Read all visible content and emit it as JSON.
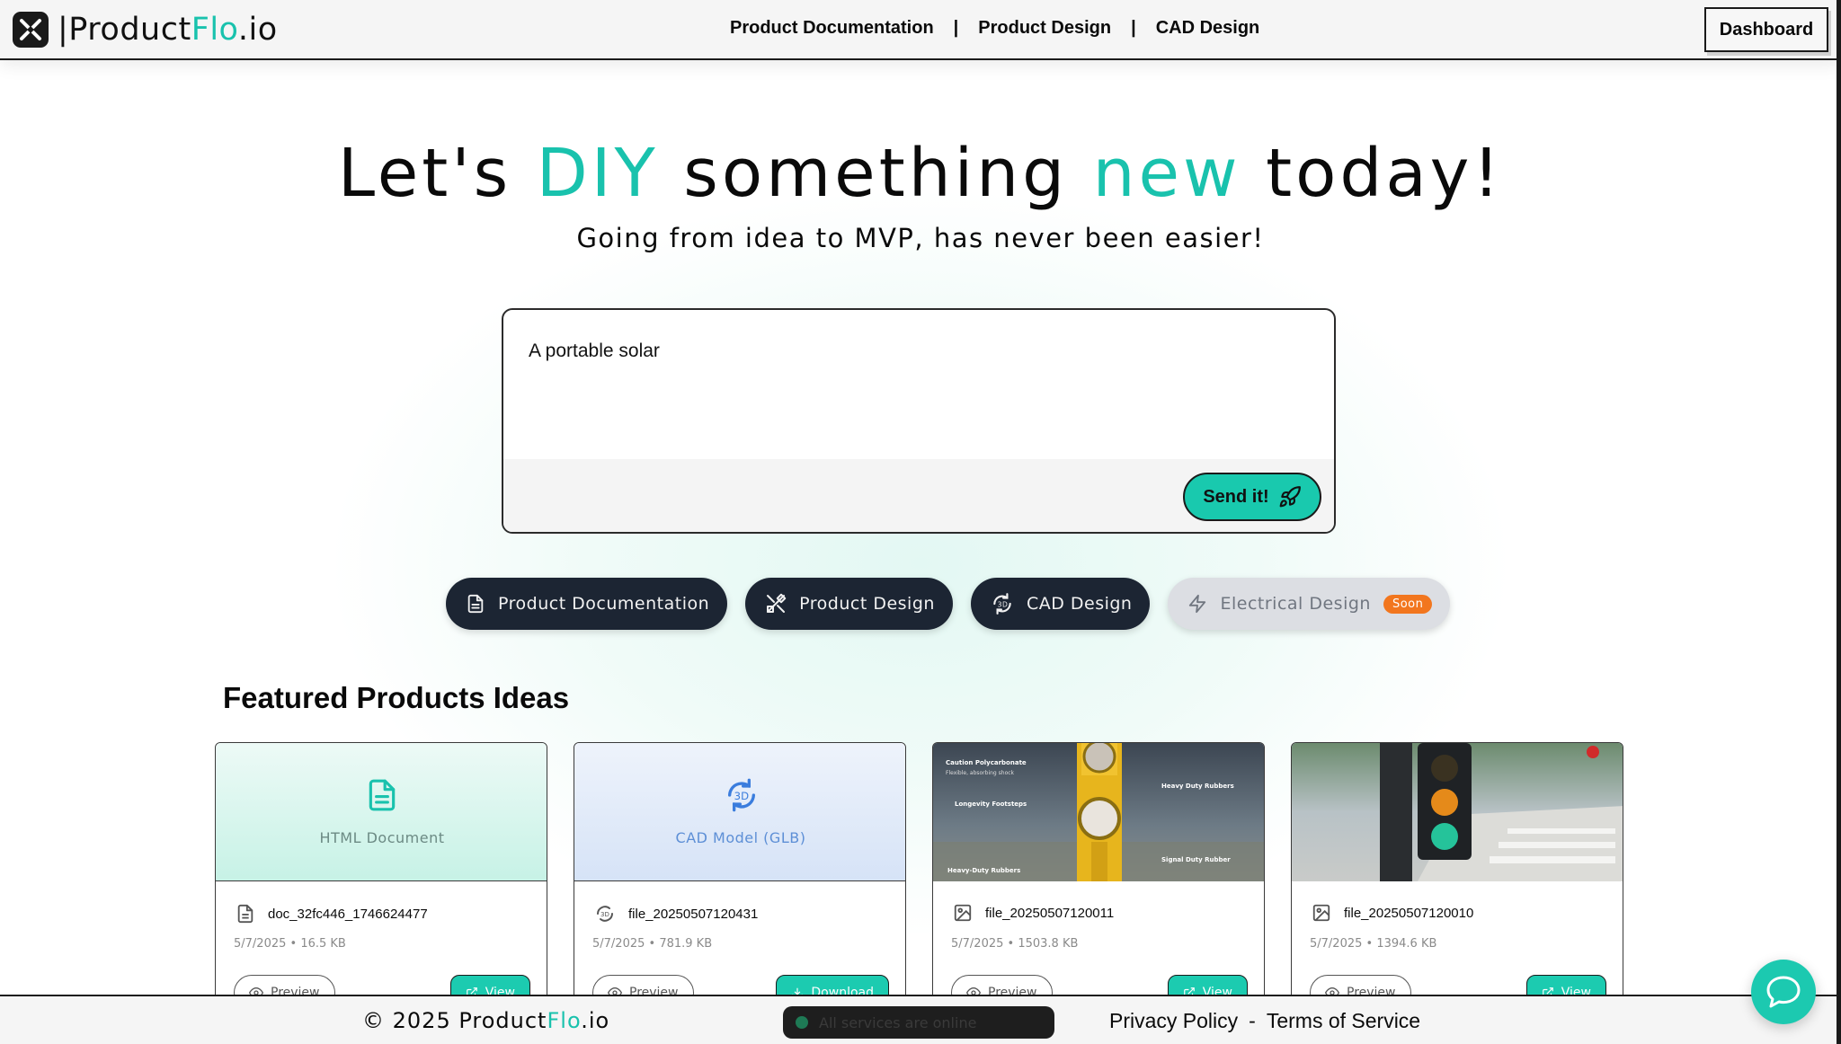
{
  "header": {
    "logo_prefix": "|Product",
    "logo_accent": "Flo",
    "logo_suffix": ".io",
    "nav": [
      "Product Documentation",
      "Product Design",
      "CAD Design"
    ],
    "nav_separator": "|",
    "dashboard_label": "Dashboard"
  },
  "hero": {
    "title_parts": [
      "Let's ",
      "DIY",
      " something ",
      "new",
      " today!"
    ],
    "subtitle": "Going from idea to MVP, has never been easier!"
  },
  "prompt": {
    "value": "A portable solar",
    "send_label": "Send it!"
  },
  "modes": [
    {
      "label": "Product Documentation",
      "icon": "document-icon"
    },
    {
      "label": "Product Design",
      "icon": "design-tools-icon"
    },
    {
      "label": "CAD Design",
      "icon": "3d-rotate-icon"
    },
    {
      "label": "Electrical Design",
      "icon": "bolt-icon",
      "badge": "Soon"
    }
  ],
  "featured": {
    "title": "Featured Products Ideas",
    "cards": [
      {
        "preview_label": "HTML Document",
        "name": "doc_32fc446_1746624477",
        "meta": "5/7/2025 • 16.5 KB",
        "primary": "Preview",
        "action": "View"
      },
      {
        "preview_label": "CAD Model (GLB)",
        "name": "file_20250507120431",
        "meta": "5/7/2025 • 781.9 KB",
        "primary": "Preview",
        "action": "Download"
      },
      {
        "preview_label": "",
        "name": "file_20250507120011",
        "meta": "5/7/2025 • 1503.8 KB",
        "primary": "Preview",
        "action": "View",
        "image_text": [
          "Caution Polycarbonate",
          "Flexible, absorbing shock",
          "Longevity Footsteps",
          "Heavy-Duty Rubbers",
          "Heavy Duty Rubbers",
          "Signal Duty Rubber"
        ]
      },
      {
        "preview_label": "",
        "name": "file_20250507120010",
        "meta": "5/7/2025 • 1394.6 KB",
        "primary": "Preview",
        "action": "View"
      }
    ]
  },
  "footer": {
    "copyright_prefix": "© 2025 Product",
    "copyright_accent": "Flo",
    "copyright_suffix": ".io",
    "status": "All services are online",
    "privacy": "Privacy Policy",
    "separator": "-",
    "terms": "Terms of Service"
  },
  "colors": {
    "accent": "#19c2ad",
    "dark": "#1c2533",
    "soon": "#f2761e"
  }
}
